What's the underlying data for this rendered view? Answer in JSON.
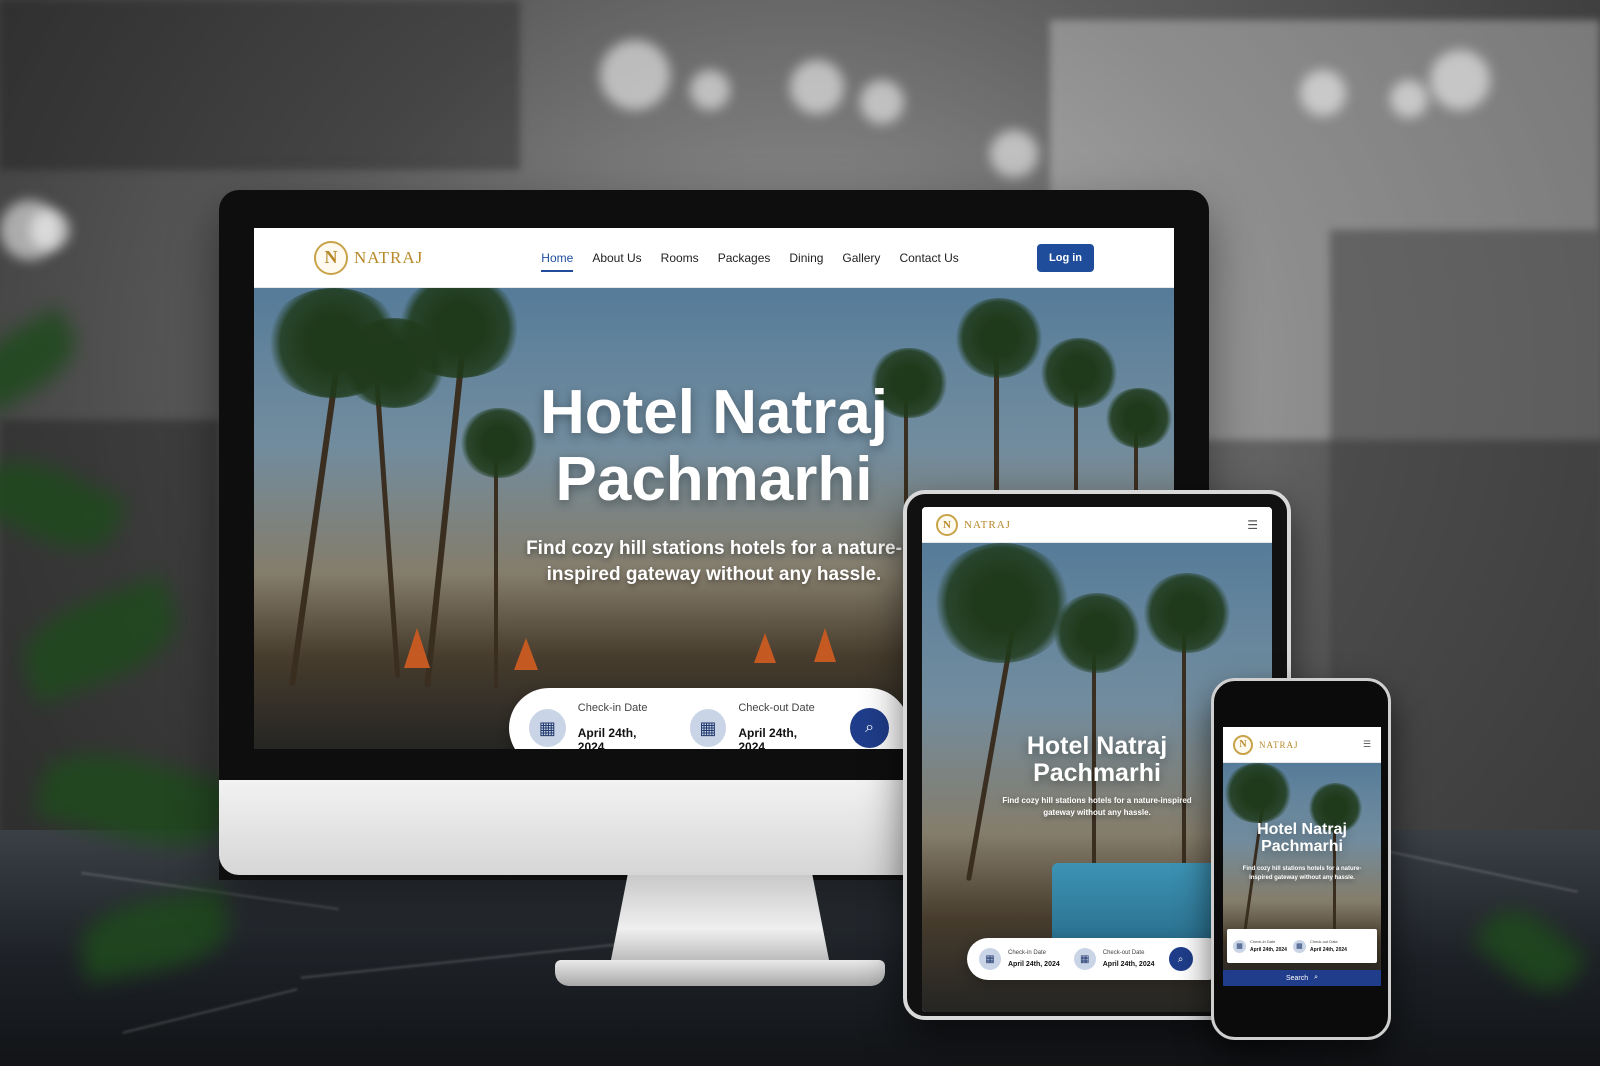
{
  "brand": {
    "logo_letter": "N",
    "logo_text": "NATRAJ",
    "gold": "#b8892a",
    "blue": "#1f4d9c"
  },
  "nav": {
    "links": [
      "Home",
      "About Us",
      "Rooms",
      "Packages",
      "Dining",
      "Gallery",
      "Contact Us"
    ],
    "login_label": "Log in",
    "menu_icon": "hamburger-icon"
  },
  "hero": {
    "title_line1": "Hotel Natraj",
    "title_line2": "Pachmarhi",
    "subtitle": "Find cozy hill stations hotels for a nature-inspired gateway without any hassle."
  },
  "booking": {
    "checkin_label": "Check-in Date",
    "checkin_value": "April 24th, 2024",
    "checkout_label": "Check-out Date",
    "checkout_value": "April 24th, 2024",
    "search_label": "Search"
  }
}
